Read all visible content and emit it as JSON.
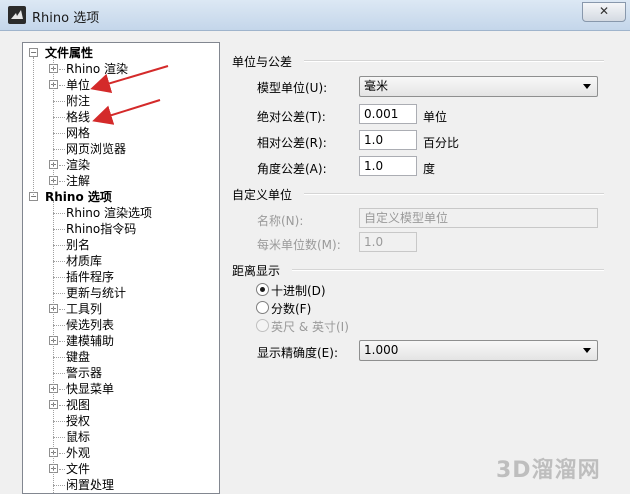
{
  "window": {
    "title": "Rhino 选项",
    "close_glyph": "✕"
  },
  "tree": [
    {
      "label": "文件属性",
      "level": 0,
      "expander": "−",
      "bold": true
    },
    {
      "label": "Rhino 渲染",
      "level": 1,
      "expander": "+"
    },
    {
      "label": "单位",
      "level": 1,
      "expander": "+"
    },
    {
      "label": "附注",
      "level": 1,
      "expander": ""
    },
    {
      "label": "格线",
      "level": 1,
      "expander": ""
    },
    {
      "label": "网格",
      "level": 1,
      "expander": ""
    },
    {
      "label": "网页浏览器",
      "level": 1,
      "expander": ""
    },
    {
      "label": "渲染",
      "level": 1,
      "expander": "+"
    },
    {
      "label": "注解",
      "level": 1,
      "expander": "+"
    },
    {
      "label": "Rhino 选项",
      "level": 0,
      "expander": "−",
      "bold": true
    },
    {
      "label": "Rhino 渲染选项",
      "level": 1,
      "expander": ""
    },
    {
      "label": "Rhino指令码",
      "level": 1,
      "expander": ""
    },
    {
      "label": "别名",
      "level": 1,
      "expander": ""
    },
    {
      "label": "材质库",
      "level": 1,
      "expander": ""
    },
    {
      "label": "插件程序",
      "level": 1,
      "expander": ""
    },
    {
      "label": "更新与统计",
      "level": 1,
      "expander": ""
    },
    {
      "label": "工具列",
      "level": 1,
      "expander": "+"
    },
    {
      "label": "候选列表",
      "level": 1,
      "expander": ""
    },
    {
      "label": "建模辅助",
      "level": 1,
      "expander": "+"
    },
    {
      "label": "键盘",
      "level": 1,
      "expander": ""
    },
    {
      "label": "警示器",
      "level": 1,
      "expander": ""
    },
    {
      "label": "快显菜单",
      "level": 1,
      "expander": "+"
    },
    {
      "label": "视图",
      "level": 1,
      "expander": "+"
    },
    {
      "label": "授权",
      "level": 1,
      "expander": ""
    },
    {
      "label": "鼠标",
      "level": 1,
      "expander": ""
    },
    {
      "label": "外观",
      "level": 1,
      "expander": "+"
    },
    {
      "label": "文件",
      "level": 1,
      "expander": "+"
    },
    {
      "label": "闲置处理",
      "level": 1,
      "expander": ""
    }
  ],
  "units_section": {
    "title": "单位与公差",
    "model_unit_label": "模型单位(U):",
    "model_unit_value": "毫米",
    "abs_tol_label": "绝对公差(T):",
    "abs_tol_value": "0.001",
    "abs_tol_unit": "单位",
    "rel_tol_label": "相对公差(R):",
    "rel_tol_value": "1.0",
    "rel_tol_unit": "百分比",
    "ang_tol_label": "角度公差(A):",
    "ang_tol_value": "1.0",
    "ang_tol_unit": "度"
  },
  "custom_section": {
    "title": "自定义单位",
    "name_label": "名称(N):",
    "name_value": "自定义模型单位",
    "per_unit_label": "每米单位数(M):",
    "per_unit_value": "1.0"
  },
  "distance_section": {
    "title": "距离显示",
    "options": [
      {
        "label": "十进制(D)",
        "checked": true,
        "disabled": false
      },
      {
        "label": "分数(F)",
        "checked": false,
        "disabled": false
      },
      {
        "label": "英尺 & 英寸(I)",
        "checked": false,
        "disabled": true
      }
    ],
    "precision_label": "显示精确度(E):",
    "precision_value": "1.000"
  },
  "watermark": "3D溜溜网",
  "colors": {
    "annotation_arrow": "#d42a2a",
    "title_bar": "#c4d6ea"
  }
}
